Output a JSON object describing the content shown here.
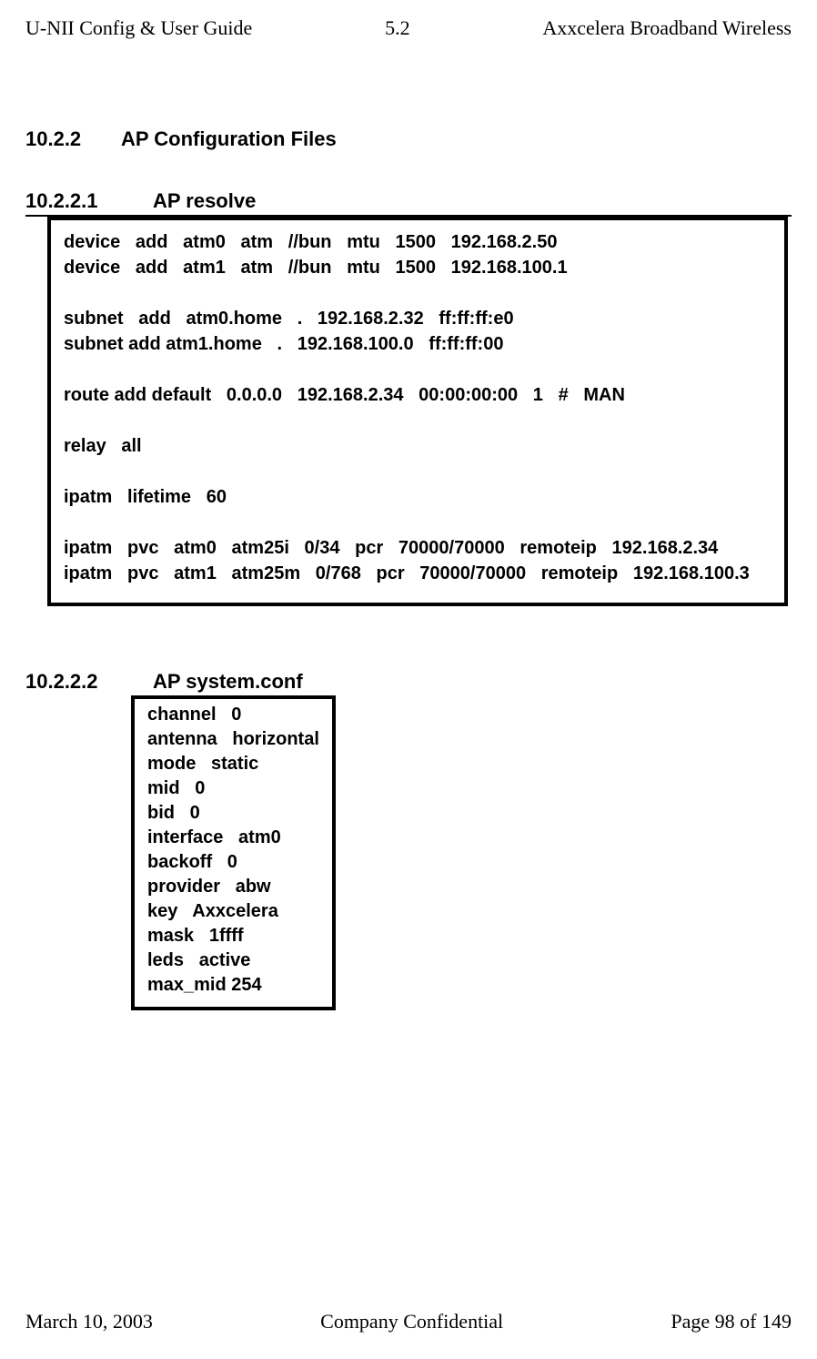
{
  "header": {
    "left": "U-NII Config & User Guide",
    "mid": "5.2",
    "right": "Axxcelera Broadband Wireless"
  },
  "section": {
    "num": "10.2.2",
    "title": "AP Configuration Files"
  },
  "sub1": {
    "num": "10.2.2.1",
    "title": "AP resolve",
    "code": "device   add   atm0   atm   //bun   mtu   1500   192.168.2.50\ndevice   add   atm1   atm   //bun   mtu   1500   192.168.100.1\n\nsubnet   add   atm0.home   .   192.168.2.32   ff:ff:ff:e0\nsubnet add atm1.home   .   192.168.100.0   ff:ff:ff:00\n\nroute add default   0.0.0.0   192.168.2.34   00:00:00:00   1   #   MAN\n\nrelay   all\n\nipatm   lifetime   60\n\nipatm   pvc   atm0   atm25i   0/34   pcr   70000/70000   remoteip   192.168.2.34\nipatm   pvc   atm1   atm25m   0/768   pcr   70000/70000   remoteip   192.168.100.3"
  },
  "sub2": {
    "num": "10.2.2.2",
    "title": "AP system.conf",
    "code": "channel   0\nantenna   horizontal\nmode   static\nmid   0\nbid   0\ninterface   atm0\nbackoff   0\nprovider   abw\nkey   Axxcelera\nmask   1ffff\nleds   active\nmax_mid 254"
  },
  "footer": {
    "left": "March 10, 2003",
    "mid": "Company Confidential",
    "right": "Page 98 of 149"
  }
}
